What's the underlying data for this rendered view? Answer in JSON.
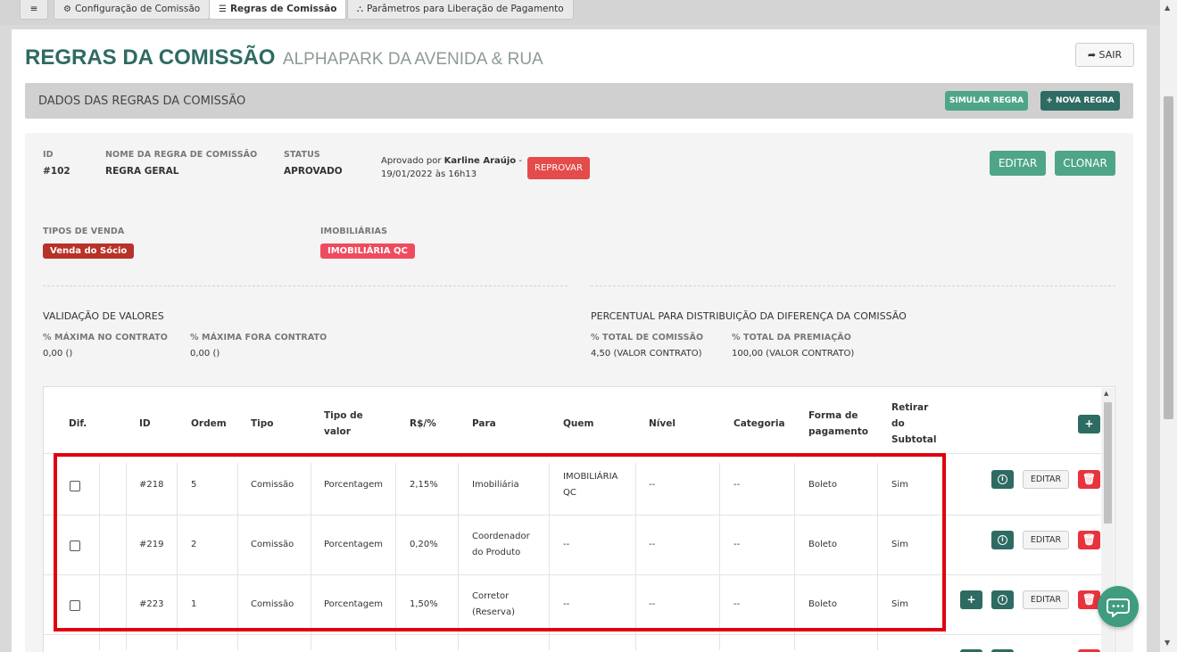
{
  "tabs": {
    "menu_icon": "≡",
    "config": "Configuração de Comissão",
    "regras": "Regras de Comissão",
    "parametros": "Parâmetros para Liberação de Pagamento"
  },
  "header": {
    "title": "REGRAS DA COMISSÃO",
    "subtitle": "ALPHAPARK DA AVENIDA & RUA",
    "sair_label": "SAIR"
  },
  "section": {
    "title": "DADOS DAS REGRAS DA COMISSÃO",
    "simular_label": "SIMULAR REGRA",
    "nova_label": "+ NOVA REGRA"
  },
  "rule": {
    "id_label": "ID",
    "id_value": "#102",
    "name_label": "NOME DA REGRA DE COMISSÃO",
    "name_value": "REGRA GERAL",
    "status_label": "STATUS",
    "status_value": "APROVADO",
    "approved_prefix": "Aprovado por",
    "approved_by": "Karline Araújo",
    "approved_suffix": "-",
    "approved_date": "19/01/2022 às 16h13",
    "reprovar_label": "REPROVAR",
    "editar_label": "EDITAR",
    "clonar_label": "CLONAR",
    "tipos_label": "TIPOS DE VENDA",
    "tipos_value": "Venda do Sócio",
    "imob_label": "IMOBILIÁRIAS",
    "imob_value": "IMOBILIÁRIA QC"
  },
  "validacao": {
    "title": "VALIDAÇÃO DE VALORES",
    "max_contrato_label": "% MÁXIMA NO CONTRATO",
    "max_contrato_value": "0,00 ()",
    "max_fora_label": "% MÁXIMA FORA CONTRATO",
    "max_fora_value": "0,00 ()"
  },
  "percentual": {
    "title": "PERCENTUAL PARA DISTRIBUIÇÃO DA DIFERENÇA DA COMISSÃO",
    "total_comissao_label": "% TOTAL DE COMISSÃO",
    "total_comissao_value": "4,50 (VALOR CONTRATO)",
    "total_premiacao_label": "% TOTAL DA PREMIAÇÃO",
    "total_premiacao_value": "100,00 (VALOR CONTRATO)"
  },
  "table": {
    "headers": {
      "dif": "Dif.",
      "id": "ID",
      "ordem": "Ordem",
      "tipo": "Tipo",
      "tipo_valor_1": "Tipo de",
      "tipo_valor_2": "valor",
      "rs": "R$/%",
      "para": "Para",
      "quem": "Quem",
      "nivel": "Nível",
      "categoria": "Categoria",
      "forma_1": "Forma de",
      "forma_2": "pagamento",
      "retirar_1": "Retirar",
      "retirar_2": "do",
      "retirar_3": "Subtotal",
      "add": "+"
    },
    "rows": [
      {
        "id": "#218",
        "ordem": "5",
        "tipo": "Comissão",
        "tipo_valor": "Porcentagem",
        "rs": "2,15%",
        "para_1": "Imobiliária",
        "para_2": "",
        "quem_1": "IMOBILIÁRIA",
        "quem_2": "QC",
        "nivel": "--",
        "categoria": "--",
        "forma": "Boleto",
        "retirar": "Sim",
        "editar": "EDITAR"
      },
      {
        "id": "#219",
        "ordem": "2",
        "tipo": "Comissão",
        "tipo_valor": "Porcentagem",
        "rs": "0,20%",
        "para_1": "Coordenador",
        "para_2": "do Produto",
        "quem_1": "--",
        "quem_2": "",
        "nivel": "--",
        "categoria": "--",
        "forma": "Boleto",
        "retirar": "Sim",
        "editar": "EDITAR"
      },
      {
        "id": "#223",
        "ordem": "1",
        "tipo": "Comissão",
        "tipo_valor": "Porcentagem",
        "rs": "1,50%",
        "para_1": "Corretor",
        "para_2": "(Reserva)",
        "quem_1": "--",
        "quem_2": "",
        "nivel": "--",
        "categoria": "--",
        "forma": "Boleto",
        "retirar": "Sim",
        "editar": "EDITAR"
      }
    ]
  },
  "colors": {
    "brand": "#2e6b62",
    "accent": "#4fa587",
    "danger": "#e44b4b",
    "highlight": "#e0000f"
  }
}
